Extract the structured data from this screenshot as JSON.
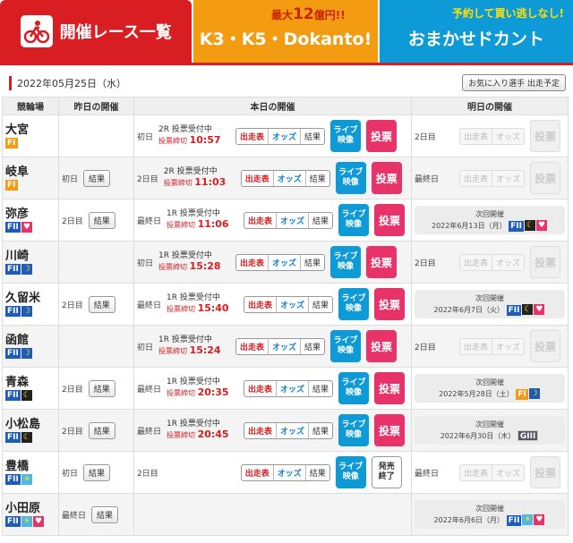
{
  "tabs": {
    "race_list": "開催レース一覧",
    "k3": "K3・K5・Dokanto!",
    "k3_top_a": "最大",
    "k3_top_b": "12",
    "k3_top_c": "億円!!",
    "omakase": "おまかせドカント",
    "omakase_top": "予約して買い逃しなし!"
  },
  "date": "2022年05月25日（水）",
  "fav_button": "お気に入り選手 出走予定",
  "headers": {
    "venue": "競輪場",
    "yesterday": "昨日の開催",
    "today": "本日の開催",
    "tomorrow": "明日の開催"
  },
  "labels": {
    "result": "結果",
    "entry": "出走表",
    "odds": "オッズ",
    "live1": "ライブ",
    "live2": "映像",
    "vote": "投票",
    "vote_done1": "発売",
    "vote_done2": "終了",
    "deadline": "投票締切",
    "next": "次回開催"
  },
  "rows": [
    {
      "venue": "大宮",
      "grade": "FI",
      "marks": [],
      "yday": "",
      "today_day": "初日",
      "race": "2R 投票受付中",
      "time": "10:57",
      "tm_type": "day",
      "tm_day": "2日目",
      "vote_state": "open"
    },
    {
      "venue": "岐阜",
      "grade": "FI",
      "marks": [],
      "yday": "初日",
      "today_day": "2日目",
      "race": "2R 投票受付中",
      "time": "11:03",
      "tm_type": "day",
      "tm_day": "最終日",
      "vote_state": "open"
    },
    {
      "venue": "弥彦",
      "grade": "FII",
      "marks": [
        "heart"
      ],
      "yday": "2日目",
      "today_day": "最終日",
      "race": "1R 投票受付中",
      "time": "11:06",
      "tm_type": "next",
      "next_date": "2022年6月13日（月）",
      "next_grade": "FII",
      "next_marks": [
        "night",
        "heart"
      ],
      "vote_state": "open"
    },
    {
      "venue": "川崎",
      "grade": "FII",
      "marks": [
        "moon"
      ],
      "yday": "",
      "today_day": "初日",
      "race": "1R 投票受付中",
      "time": "15:28",
      "tm_type": "day",
      "tm_day": "2日目",
      "vote_state": "open"
    },
    {
      "venue": "久留米",
      "grade": "FII",
      "marks": [
        "moon"
      ],
      "yday": "2日目",
      "today_day": "最終日",
      "race": "1R 投票受付中",
      "time": "15:40",
      "tm_type": "next",
      "next_date": "2022年6月7日（火）",
      "next_grade": "FII",
      "next_marks": [
        "night",
        "heart"
      ],
      "vote_state": "open"
    },
    {
      "venue": "函館",
      "grade": "FII",
      "marks": [
        "moon"
      ],
      "yday": "",
      "today_day": "初日",
      "race": "1R 投票受付中",
      "time": "15:24",
      "tm_type": "day",
      "tm_day": "2日目",
      "vote_state": "open"
    },
    {
      "venue": "青森",
      "grade": "FII",
      "marks": [
        "night"
      ],
      "yday": "2日目",
      "today_day": "最終日",
      "race": "1R 投票受付中",
      "time": "20:35",
      "tm_type": "next",
      "next_date": "2022年5月28日（土）",
      "next_grade": "FI",
      "next_marks": [
        "moon"
      ],
      "vote_state": "open"
    },
    {
      "venue": "小松島",
      "grade": "FII",
      "marks": [
        "night"
      ],
      "yday": "2日目",
      "today_day": "最終日",
      "race": "1R 投票受付中",
      "time": "20:45",
      "tm_type": "next",
      "next_date": "2022年6月30日（木）",
      "next_grade": "GIII",
      "next_marks": [],
      "vote_state": "open"
    },
    {
      "venue": "豊橋",
      "grade": "FII",
      "marks": [
        "sun"
      ],
      "yday": "初日",
      "today_day": "2日目",
      "race": "",
      "time": "",
      "tm_type": "day",
      "tm_day": "最終日",
      "vote_state": "done"
    },
    {
      "venue": "小田原",
      "grade": "FII",
      "marks": [
        "sun",
        "heart"
      ],
      "yday": "最終日",
      "today_day": "",
      "race": "",
      "time": "",
      "tm_type": "next",
      "next_date": "2022年6月6日（月）",
      "next_grade": "FII",
      "next_marks": [
        "sun",
        "heart"
      ],
      "vote_state": "none"
    }
  ]
}
